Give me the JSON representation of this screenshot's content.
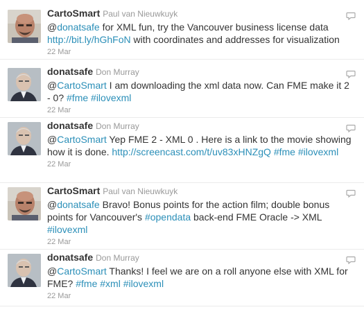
{
  "icons": {
    "reply": "reply-icon"
  },
  "colors": {
    "link": "#2b8fb8",
    "username": "#333333",
    "fullname": "#999999"
  },
  "tweets": [
    {
      "screen_name": "CartoSmart",
      "full_name": "Paul van Nieuwkuyk",
      "time": "22 Mar",
      "segments": [
        {
          "t": "@",
          "link": false
        },
        {
          "t": "donatsafe",
          "link": true
        },
        {
          "t": " for XML fun, try the Vancouver business license data ",
          "link": false
        },
        {
          "t": "http://bit.ly/hGhFoN",
          "link": true
        },
        {
          "t": " with coordinates and addresses for visualization",
          "link": false
        }
      ]
    },
    {
      "screen_name": "donatsafe",
      "full_name": "Don Murray",
      "time": "22 Mar",
      "segments": [
        {
          "t": "@",
          "link": false
        },
        {
          "t": "CartoSmart",
          "link": true
        },
        {
          "t": " I am downloading the xml data now. Can FME make it 2 - 0? ",
          "link": false
        },
        {
          "t": "#fme",
          "link": true
        },
        {
          "t": " ",
          "link": false
        },
        {
          "t": "#ilovexml",
          "link": true
        }
      ]
    },
    {
      "screen_name": "donatsafe",
      "full_name": "Don Murray",
      "time": "22 Mar",
      "segments": [
        {
          "t": "@",
          "link": false
        },
        {
          "t": "CartoSmart",
          "link": true
        },
        {
          "t": " Yep FME 2 - XML 0 . Here is a link to the movie showing how it is done. ",
          "link": false
        },
        {
          "t": "http://screencast.com/t/uv83xHNZgQ",
          "link": true
        },
        {
          "t": " ",
          "link": false
        },
        {
          "t": "#fme",
          "link": true
        },
        {
          "t": " ",
          "link": false
        },
        {
          "t": "#ilovexml",
          "link": true
        }
      ]
    },
    {
      "screen_name": "CartoSmart",
      "full_name": "Paul van Nieuwkuyk",
      "time": "22 Mar",
      "segments": [
        {
          "t": "@",
          "link": false
        },
        {
          "t": "donatsafe",
          "link": true
        },
        {
          "t": " Bravo! Bonus points for the action film; double bonus points for Vancouver's ",
          "link": false
        },
        {
          "t": "#opendata",
          "link": true
        },
        {
          "t": " back-end FME Oracle -> XML ",
          "link": false
        },
        {
          "t": "#ilovexml",
          "link": true
        }
      ]
    },
    {
      "screen_name": "donatsafe",
      "full_name": "Don Murray",
      "time": "22 Mar",
      "segments": [
        {
          "t": "@",
          "link": false
        },
        {
          "t": "CartoSmart",
          "link": true
        },
        {
          "t": " Thanks! I feel we are on a roll anyone else with XML for FME? ",
          "link": false
        },
        {
          "t": "#fme",
          "link": true
        },
        {
          "t": " ",
          "link": false
        },
        {
          "t": "#xml",
          "link": true
        },
        {
          "t": " ",
          "link": false
        },
        {
          "t": "#ilovexml",
          "link": true
        }
      ]
    }
  ]
}
